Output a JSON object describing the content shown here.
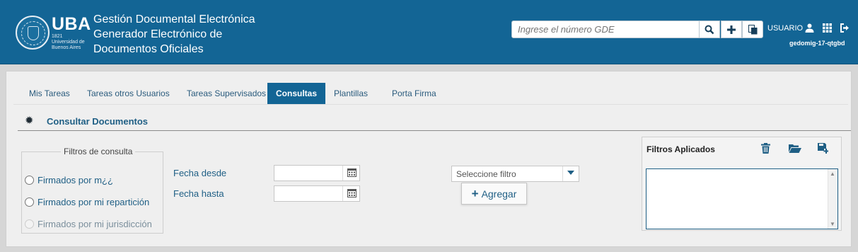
{
  "header": {
    "brand": "UBA",
    "brand_sub": "1821 Universidad de Buenos Aires",
    "title_lines": [
      "Gestión Documental Electrónica",
      "Generador Electrónico de",
      "Documentos Oficiales"
    ],
    "search": {
      "placeholder": "Ingrese el número GDE"
    },
    "buttons": [
      "search-icon",
      "plus-icon",
      "copy-icon"
    ],
    "user_label": "USUARIO",
    "icons": [
      "user-icon",
      "apps-grid-icon",
      "logout-icon"
    ],
    "instance_id": "gedomig-17-qtgbd",
    "colors": {
      "bar": "#136595",
      "accent": "#1f5f85"
    }
  },
  "tabs": [
    "Mis Tareas",
    "Tareas otros Usuarios",
    "Tareas Supervisados",
    "Consultas",
    "Plantillas",
    "Porta Firma"
  ],
  "active_tab": "Consultas",
  "section_title": "Consultar Documentos",
  "filters": {
    "legend": "Filtros de consulta",
    "options": [
      "Firmados por m¿¿",
      "Firmados por mi repartición",
      "Firmados por mi jurisdicción"
    ]
  },
  "dates": {
    "from_label": "Fecha desde",
    "to_label": "Fecha hasta"
  },
  "filter_select": {
    "placeholder": "Seleccione filtro",
    "add_label": "Agregar"
  },
  "applied": {
    "title": "Filtros Aplicados",
    "icons": [
      "trash-icon",
      "folder-open-icon",
      "save-icon"
    ]
  }
}
